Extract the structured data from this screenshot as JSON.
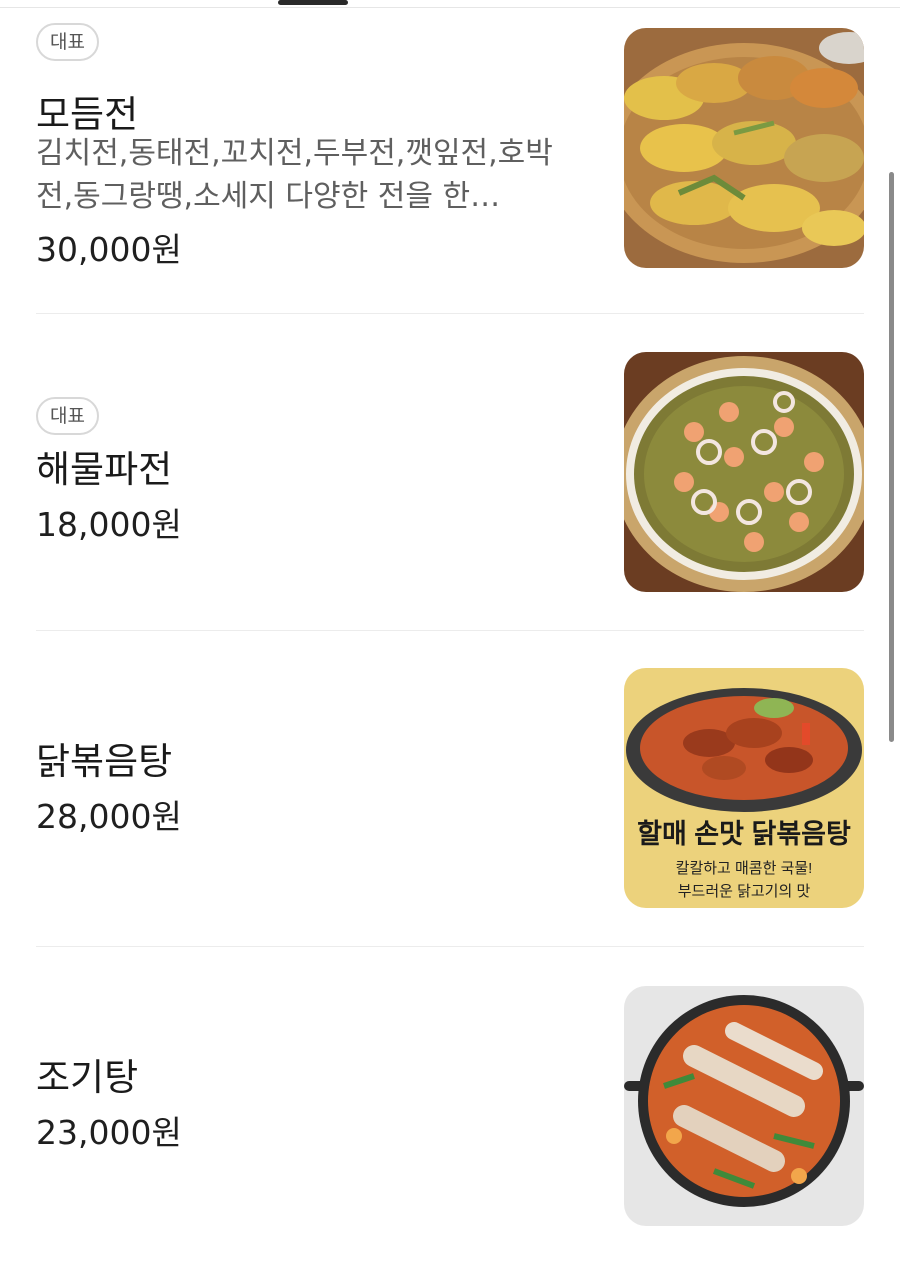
{
  "menu": {
    "items": [
      {
        "badge": "대표",
        "name": "모듬전",
        "description": "김치전,동태전,꼬치전,두부전,깻잎전,호박전,동그랑땡,소세지 다양한 전을 한…",
        "price": "30,000원",
        "image_icon": "jeon-platter-photo"
      },
      {
        "badge": "대표",
        "name": "해물파전",
        "price": "18,000원",
        "image_icon": "seafood-pancake-photo"
      },
      {
        "name": "닭볶음탕",
        "price": "28,000원",
        "image_icon": "braised-chicken-photo",
        "image_text": {
          "headline": "할매 손맛 닭볶음탕",
          "line1": "칼칼하고 매콤한 국물!",
          "line2": "부드러운 닭고기의 맛"
        }
      },
      {
        "name": "조기탕",
        "price": "23,000원",
        "image_icon": "croaker-stew-photo"
      }
    ]
  },
  "colors": {
    "background": "#ffffff",
    "text_primary": "#1a1a1a",
    "text_secondary": "#5f5f5f",
    "divider": "#ececec",
    "badge_border": "#d8d8d8",
    "scrollbar": "#8a8a8a"
  }
}
